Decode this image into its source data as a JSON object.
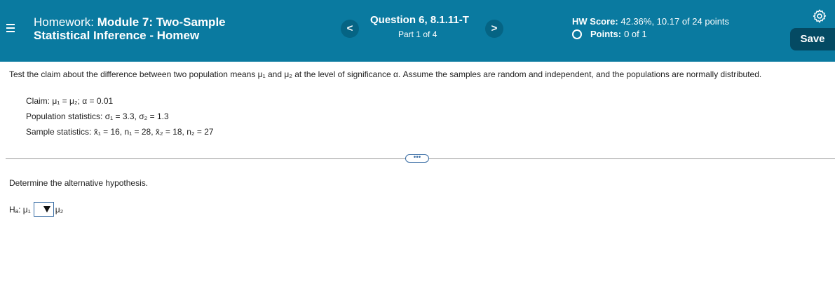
{
  "header": {
    "hw_label": "Homework:",
    "hw_name_line1": "Module 7: Two-Sample",
    "hw_name_line2": "Statistical Inference - Homew",
    "prev_label": "<",
    "next_label": ">",
    "question_title": "Question 6, 8.1.11-T",
    "question_part": "Part 1 of 4",
    "score_label": "HW Score:",
    "score_value": "42.36%, 10.17 of 24 points",
    "points_label": "Points:",
    "points_value": "0 of 1",
    "save_label": "Save",
    "colors": {
      "bar": "#0a7aa0",
      "save": "#044a63"
    }
  },
  "question": {
    "intro": "Test the claim about the difference between two population means μ₁ and μ₂ at the level of significance α. Assume the samples are random and independent, and the populations are normally distributed.",
    "claim_label": "Claim:",
    "claim_text": "μ₁ = μ₂; α = 0.01",
    "pop_label": "Population statistics:",
    "pop_text": "σ₁ = 3.3, σ₂ = 1.3",
    "sample_label": "Sample statistics:",
    "sample_text": "x̄₁ = 16, n₁ = 28, x̄₂ = 18, n₂ = 27",
    "divider_handle": "•••",
    "prompt": "Determine the alternative hypothesis.",
    "ha_prefix": "Hₐ: μ₁",
    "ha_suffix": "μ₂"
  }
}
